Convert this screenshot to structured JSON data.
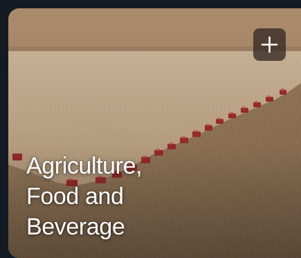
{
  "card": {
    "title_lines": [
      "Agriculture,",
      "Food and",
      "Beverage"
    ],
    "image": "aerial-field-harvesters",
    "add_icon": "plus-icon"
  },
  "colors": {
    "page_background": "#141a24",
    "button_background": "#362a22",
    "title_text": "#ffffff"
  }
}
